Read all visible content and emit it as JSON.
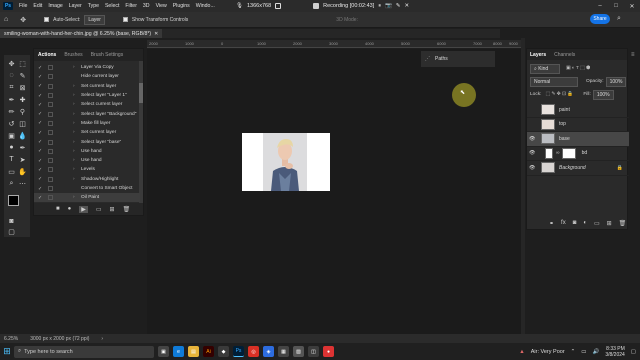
{
  "menubar": {
    "logo": "Ps",
    "items": [
      "File",
      "Edit",
      "Image",
      "Layer",
      "Type",
      "Select",
      "Filter",
      "3D",
      "View",
      "Plugins",
      "Windo..."
    ],
    "resolution": "1366x768",
    "recording": "Recording [00:02:43]"
  },
  "options_bar": {
    "auto_select_label": "Auto-Select:",
    "auto_select_value": "Layer",
    "transform_label": "Show Transform Controls",
    "mode_3d": "3D Mode:",
    "share_label": "Share"
  },
  "document": {
    "tab_title": "smiling-woman-with-hand-her-chin.jpg @ 6.25% (base, RGB/8*)",
    "ruler_marks": [
      "2000",
      "1000",
      "0",
      "1000",
      "2000",
      "3000",
      "4000",
      "5000",
      "6000",
      "7000",
      "8000",
      "9000"
    ]
  },
  "actions_panel": {
    "tabs": [
      "Actions",
      "Brushes",
      "Brush Settings"
    ],
    "items": [
      "Layer Via Copy",
      "Hide current layer",
      "Set current layer",
      "Select layer \"Layer 1\"",
      "Select current layer",
      "Select layer \"Background\"",
      "Make fill layer",
      "Set current layer",
      "Select layer \"base\"",
      "Use hand",
      "Use hand",
      "Levels",
      "Shadow/Highlight",
      "Convert to Smart Object",
      "Oil Paint"
    ]
  },
  "paths_panel": {
    "label": "Paths"
  },
  "layers_panel": {
    "tabs": [
      "Layers",
      "Channels"
    ],
    "filter_kind": "Kind",
    "blend_mode": "Normal",
    "opacity_label": "Opacity:",
    "opacity_value": "100%",
    "lock_label": "Lock:",
    "fill_label": "Fill:",
    "fill_value": "100%",
    "layers": [
      {
        "name": "paint",
        "visible": false
      },
      {
        "name": "top",
        "visible": false
      },
      {
        "name": "base",
        "visible": true
      },
      {
        "name": "bd",
        "visible": true
      },
      {
        "name": "Background",
        "visible": true
      }
    ]
  },
  "status_bar": {
    "zoom": "6.25%",
    "doc_size": "3000 px x 2000 px (72 ppi)"
  },
  "taskbar": {
    "search_placeholder": "Type here to search",
    "weather": "Air: Very Poor",
    "time": "8:33 PM",
    "date": "3/8/2024"
  },
  "colors": {
    "accent_blue": "#1473e6",
    "cursor_highlight": "#c4be28"
  }
}
